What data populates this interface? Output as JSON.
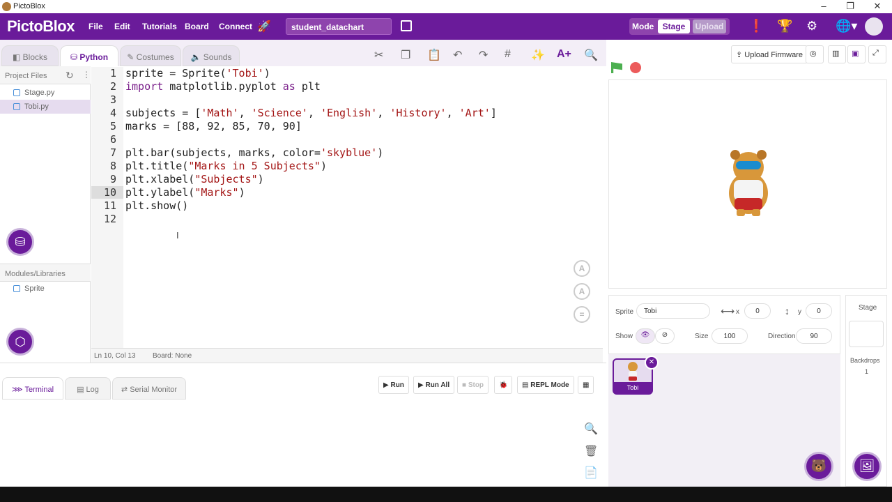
{
  "window": {
    "title": "PictoBlox",
    "minimize": "–",
    "maximize": "❐",
    "close": "✕"
  },
  "menubar": {
    "brand": "PictoBlox",
    "menus": [
      "File",
      "Edit",
      "Tutorials",
      "Board",
      "Connect"
    ],
    "project_name": "student_datachart",
    "mode_label": "Mode",
    "stage_label": "Stage",
    "upload_label": "Upload"
  },
  "tabs": {
    "blocks": "Blocks",
    "python": "Python",
    "costumes": "Costumes",
    "sounds": "Sounds"
  },
  "toolbar": {
    "upload_firmware": "Upload Firmware"
  },
  "files": {
    "header": "Project Files",
    "items": [
      "Stage.py",
      "Tobi.py"
    ],
    "modules_header": "Modules/Libraries",
    "modules": [
      "Sprite"
    ]
  },
  "editor": {
    "lines": [
      "1",
      "2",
      "3",
      "4",
      "5",
      "6",
      "7",
      "8",
      "9",
      "10",
      "11",
      "12"
    ],
    "current_line": "10",
    "code": {
      "l1a": "sprite = Sprite(",
      "l1b": "'Tobi'",
      "l1c": ")",
      "l2a": "import",
      "l2b": " matplotlib.pyplot ",
      "l2c": "as",
      "l2d": " plt",
      "l4a": "subjects = [",
      "l4b": "'Math'",
      "l4c": ", ",
      "l4d": "'Science'",
      "l4e": ", ",
      "l4f": "'English'",
      "l4g": ", ",
      "l4h": "'History'",
      "l4i": ", ",
      "l4j": "'Art'",
      "l4k": "]",
      "l5": "marks = [88, 92, 85, 70, 90]",
      "l7a": "plt.bar(subjects, marks, color=",
      "l7b": "'skyblue'",
      "l7c": ")",
      "l8a": "plt.title(",
      "l8b": "\"Marks in 5 Subjects\"",
      "l8c": ")",
      "l9a": "plt.xlabel(",
      "l9b": "\"Subjects\"",
      "l9c": ")",
      "l10a": "plt.ylabel(",
      "l10b": "\"Marks\"",
      "l10c": ")",
      "l11": "plt.show()"
    },
    "status_pos": "Ln 10, Col 13",
    "status_board": "Board: None"
  },
  "console": {
    "tabs": [
      "Terminal",
      "Log",
      "Serial Monitor"
    ],
    "run": "Run",
    "run_all": "Run All",
    "stop": "Stop",
    "repl": "REPL Mode"
  },
  "sprite_info": {
    "sprite_label": "Sprite",
    "sprite_name": "Tobi",
    "x_label": "x",
    "x": "0",
    "y_label": "y",
    "y": "0",
    "show_label": "Show",
    "size_label": "Size",
    "size": "100",
    "direction_label": "Direction",
    "direction": "90"
  },
  "sprite_list": [
    {
      "name": "Tobi"
    }
  ],
  "stage_panel": {
    "title": "Stage",
    "backdrops_label": "Backdrops",
    "backdrops_count": "1"
  },
  "colors": {
    "brand": "#6a1b9a",
    "keyword": "#7a1f8a",
    "string": "#a31515"
  }
}
